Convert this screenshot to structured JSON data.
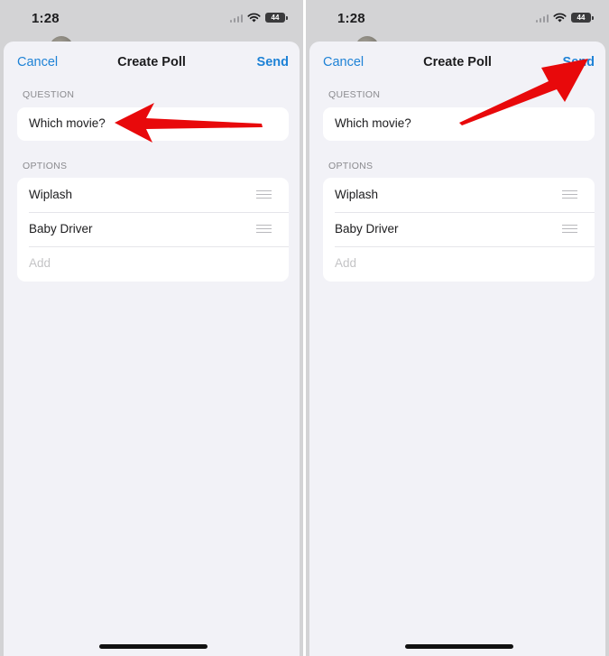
{
  "status_bar": {
    "time": "1:28",
    "battery": "44"
  },
  "nav": {
    "cancel_label": "Cancel",
    "title": "Create Poll",
    "send_label": "Send"
  },
  "question": {
    "section_label": "QUESTION",
    "value": "Which movie?"
  },
  "options": {
    "section_label": "OPTIONS",
    "items": [
      "Wiplash",
      "Baby Driver"
    ],
    "add_placeholder": "Add"
  },
  "colors": {
    "accent": "#1e82d6",
    "annotation_arrow": "#e8090b",
    "sheet_background": "#f2f2f7"
  },
  "icons": [
    "wifi-icon",
    "cellular-signal-icon",
    "battery-icon",
    "drag-handle-icon"
  ],
  "annotations": [
    {
      "screen": "left",
      "points_to": "question-input"
    },
    {
      "screen": "right",
      "points_to": "send-button"
    }
  ]
}
